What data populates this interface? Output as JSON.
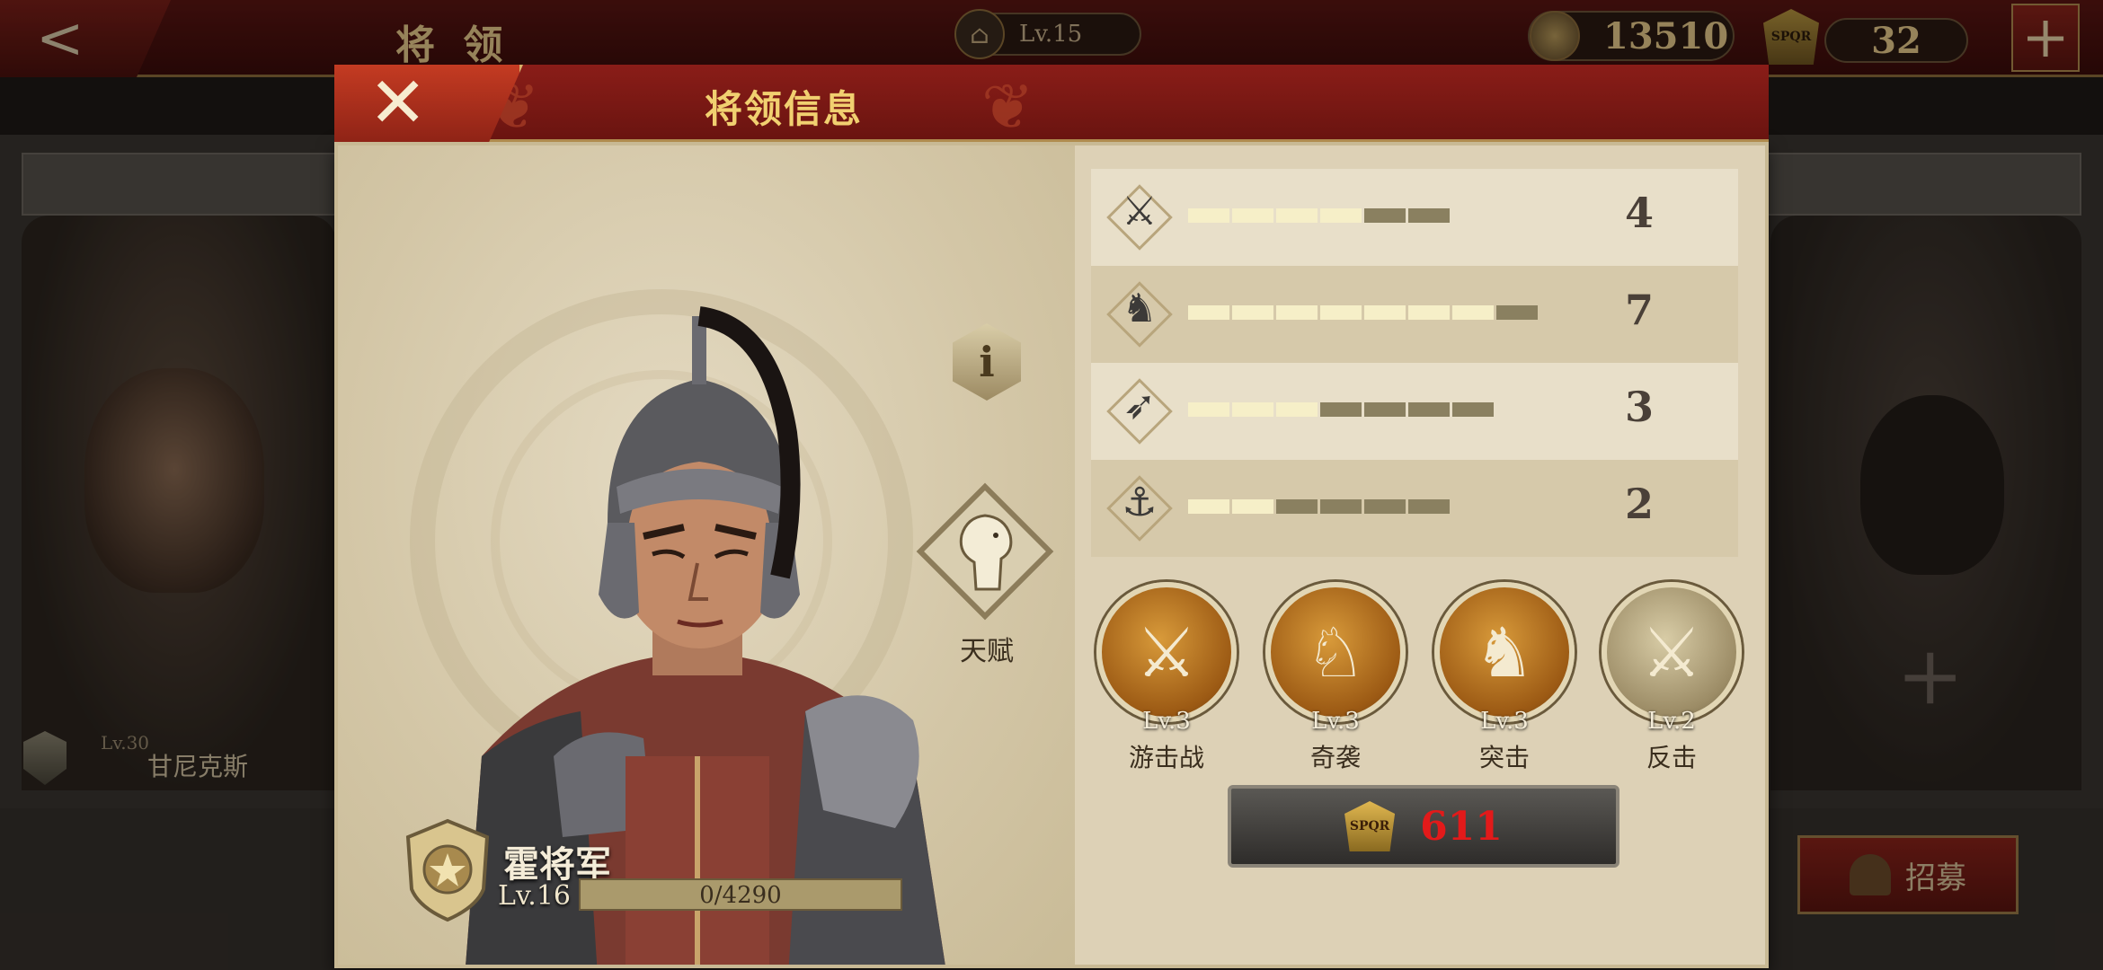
{
  "background": {
    "title": "将 领",
    "level_chip": "Lv.15",
    "coins": "13510",
    "spor_count": "32",
    "plus": "+",
    "back": "<",
    "left_card": {
      "level": "Lv.30",
      "name": "甘尼克斯"
    },
    "recruit_label": "招募",
    "add_slot": "+"
  },
  "modal": {
    "title": "将领信息",
    "close_icon": "✕",
    "info_icon": "i",
    "talent_label": "天赋",
    "general": {
      "name": "霍将军",
      "level": "Lv.16",
      "xp_text": "0/4290",
      "xp_progress": 0.0
    },
    "stats": [
      {
        "icon": "sword-icon",
        "glyph": "⚔",
        "filled": 4,
        "total": 6,
        "value": "4"
      },
      {
        "icon": "horse-icon",
        "glyph": "♞",
        "filled": 7,
        "total": 8,
        "value": "7"
      },
      {
        "icon": "bow-icon",
        "glyph": "➶",
        "filled": 3,
        "total": 7,
        "value": "3"
      },
      {
        "icon": "anchor-icon",
        "glyph": "⚓",
        "filled": 2,
        "total": 6,
        "value": "2"
      }
    ],
    "skills": [
      {
        "level": "Lv.3",
        "name": "游击战",
        "style": "gold",
        "glyph": "⚔"
      },
      {
        "level": "Lv.3",
        "name": "奇袭",
        "style": "gold",
        "glyph": "♘"
      },
      {
        "level": "Lv.3",
        "name": "突击",
        "style": "gold",
        "glyph": "♞"
      },
      {
        "level": "Lv.2",
        "name": "反击",
        "style": "grey",
        "glyph": "⚔"
      }
    ],
    "price": {
      "icon": "spor-icon",
      "badge_text": "SPQR",
      "value": "611"
    }
  }
}
